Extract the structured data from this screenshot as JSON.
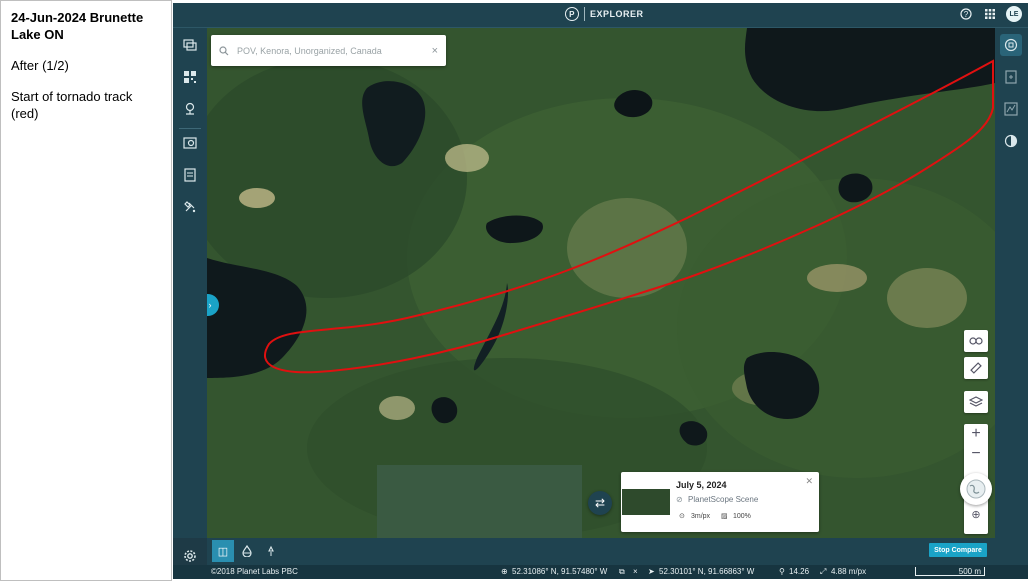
{
  "slide": {
    "title": "24-Jun-2024 Brunette Lake ON",
    "subtitle": "After (1/2)",
    "note": "Start of tornado track (red)"
  },
  "app": {
    "title": "EXPLORER",
    "logo_letter": "P",
    "avatar_initials": "LE",
    "accent_color": "#1aa3c7",
    "panel_color": "#1f4350",
    "track_color": "#e01010"
  },
  "search": {
    "placeholder": "POV, Kenora, Unorganized, Canada"
  },
  "scene_card": {
    "date": "July 5, 2024",
    "type": "PlanetScope Scene",
    "resolution": "3m/px",
    "coverage": "100%"
  },
  "bottom": {
    "stop_compare_label": "Stop Compare"
  },
  "status": {
    "copyright": "©2018 Planet Labs PBC",
    "coord_1": "52.31086° N, 91.57480° W",
    "coord_2": "52.30101° N, 91.66863° W",
    "zoom": "14.26",
    "resolution": "4.88 m/px",
    "scale_label": "500 m"
  },
  "icons": {
    "top": [
      "help-icon",
      "apps-grid-icon"
    ],
    "left_rail": [
      "layers-stack-icon",
      "grid-icon",
      "pin-icon",
      "image-search-icon",
      "document-icon",
      "satellite-icon",
      "settings-icon"
    ],
    "right_rail": [
      "compare-icon",
      "add-note-icon",
      "chart-icon",
      "contrast-icon"
    ],
    "map_tools": [
      "link-icon",
      "ruler-icon",
      "layers-icon",
      "zoom-in-icon",
      "zoom-out-icon",
      "globe-icon",
      "zoom-extent-icon"
    ]
  }
}
